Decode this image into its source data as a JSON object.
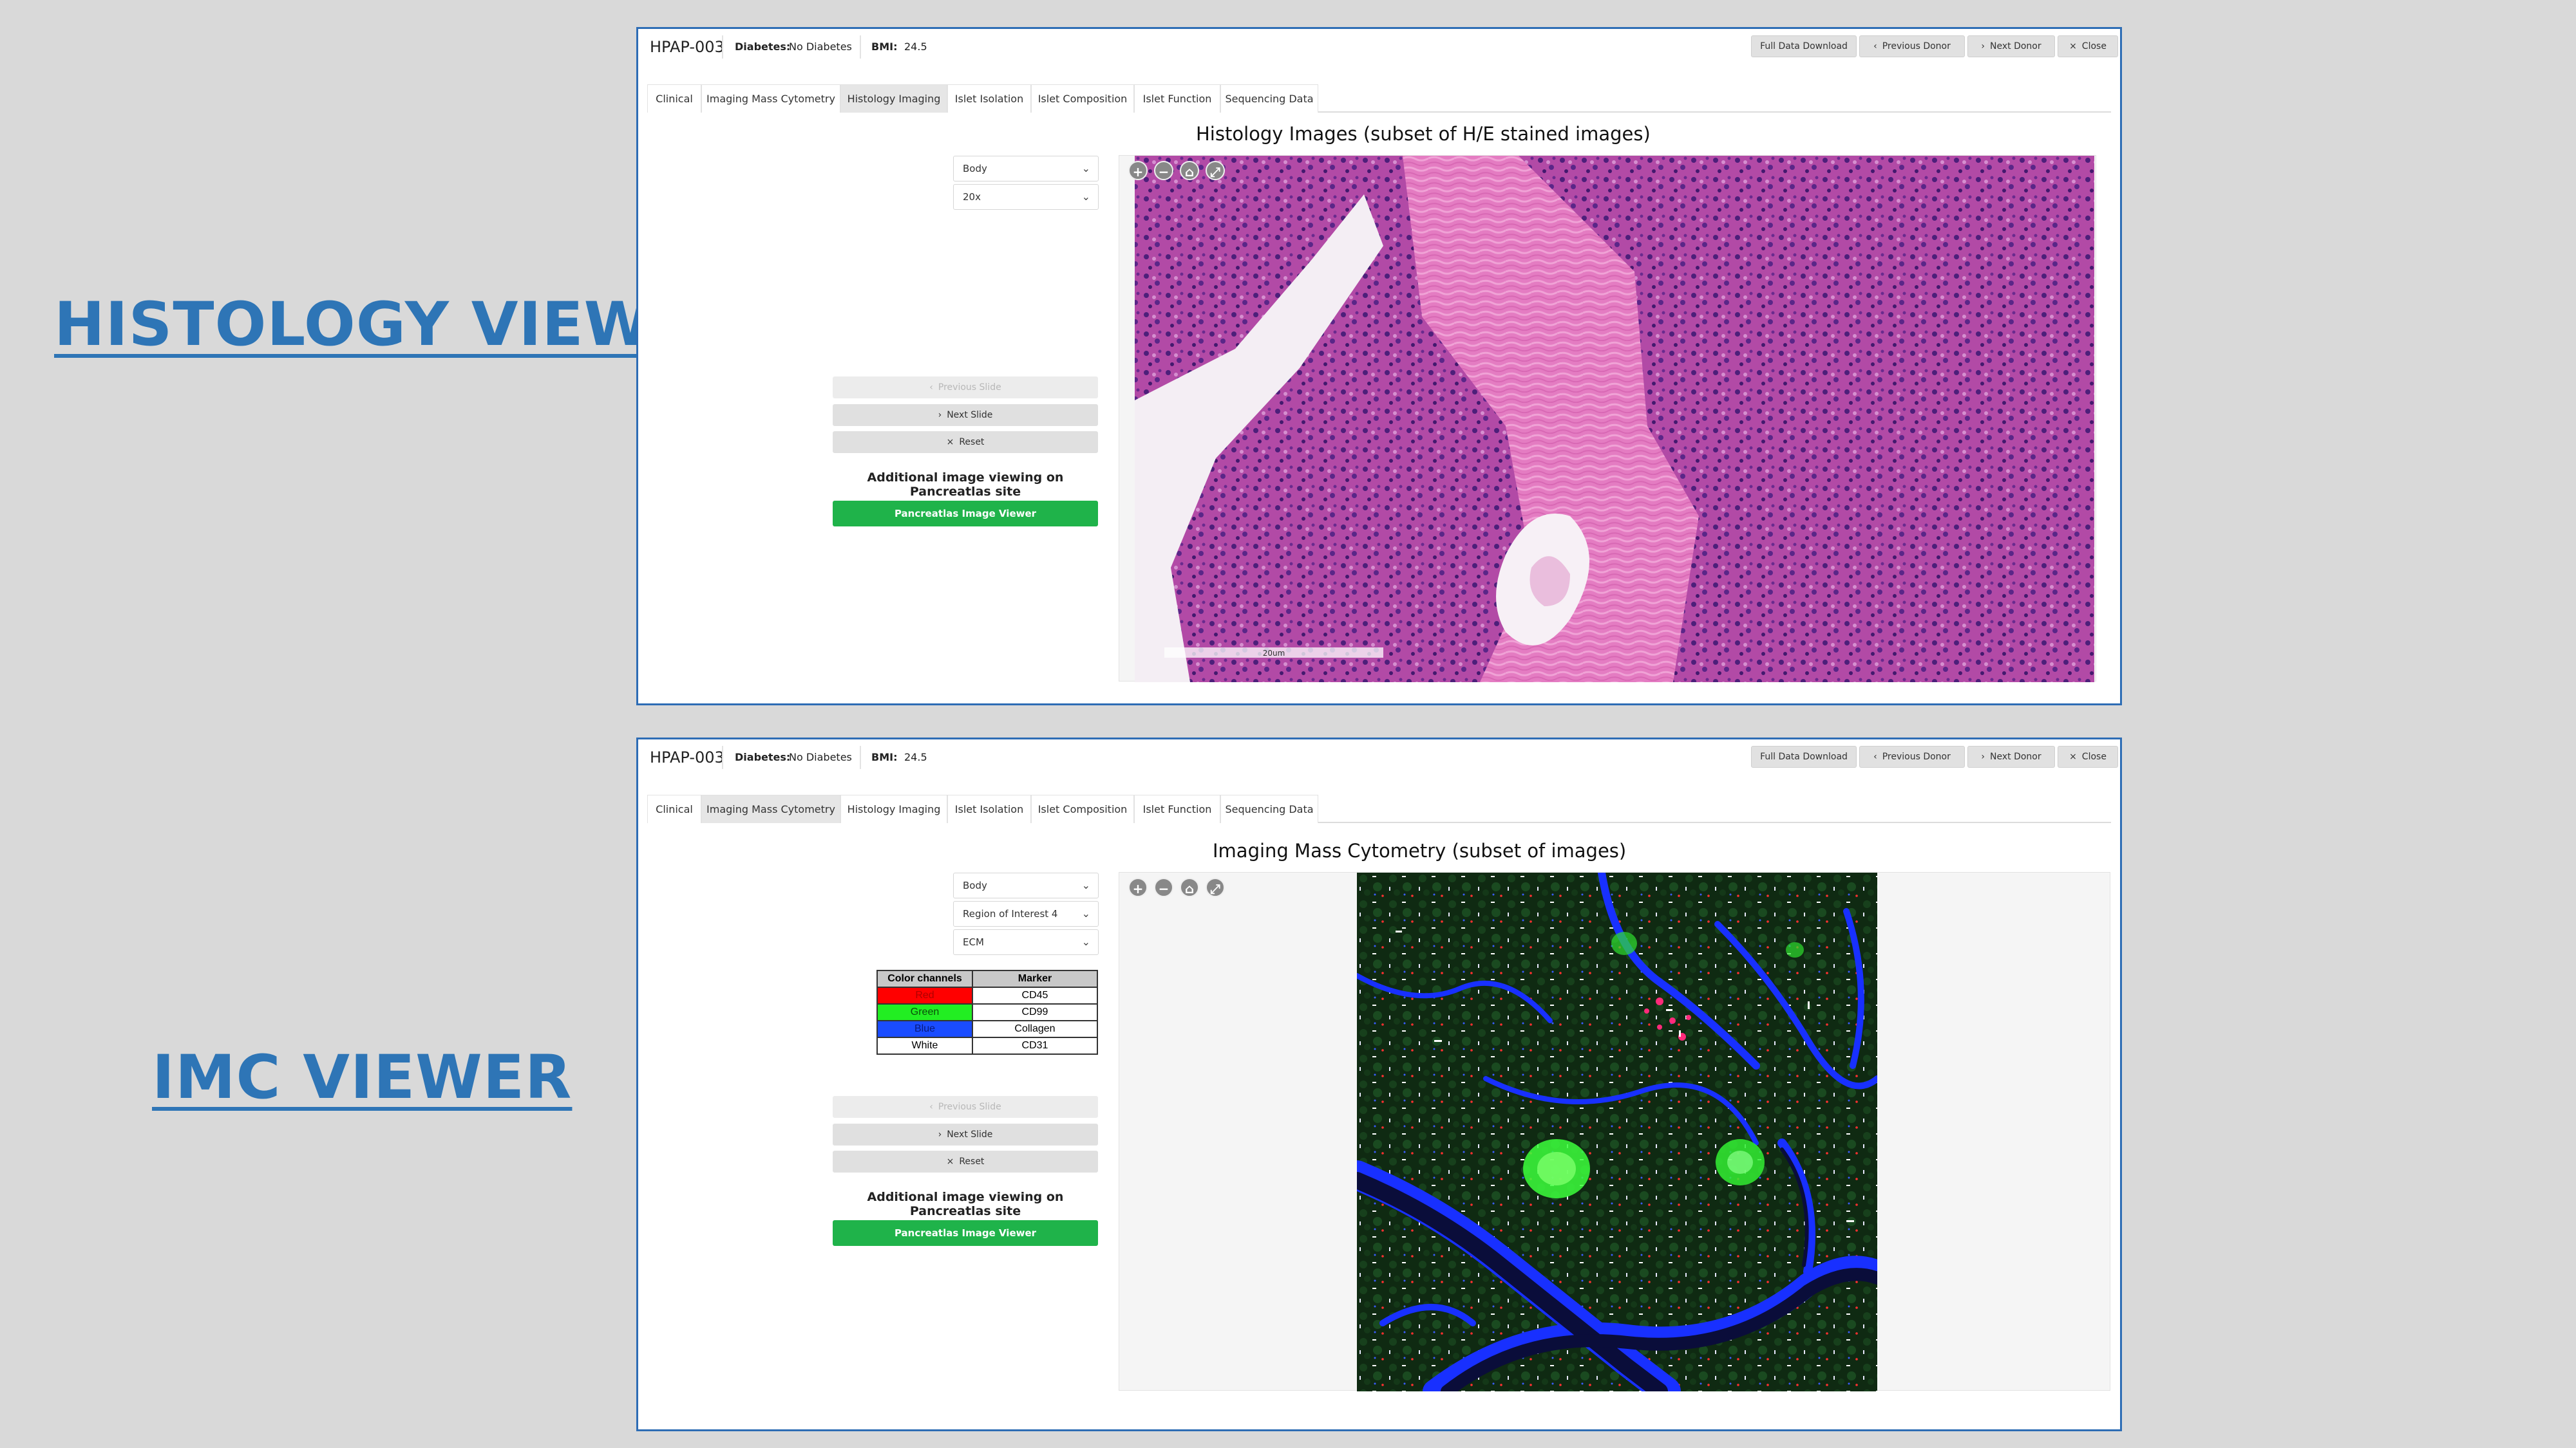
{
  "labels": {
    "histology": "HISTOLOGY VIEWER",
    "imc": "IMC VIEWER"
  },
  "donor": {
    "id": "HPAP-003",
    "diabetes_label": "Diabetes:",
    "diabetes_value": "No Diabetes",
    "bmi_label": "BMI:",
    "bmi_value": "24.5"
  },
  "header_buttons": {
    "download": "Full Data Download",
    "previous": "Previous Donor",
    "next": "Next Donor",
    "close": "Close"
  },
  "tabs": [
    "Clinical",
    "Imaging Mass Cytometry",
    "Histology Imaging",
    "Islet Isolation",
    "Islet Composition",
    "Islet Function",
    "Sequencing Data"
  ],
  "histology": {
    "active_tab": "Histology Imaging",
    "title": "Histology Images (subset of H/E stained images)",
    "region_select": "Body",
    "zoom_select": "20x",
    "scale_bar": "20um"
  },
  "imc": {
    "active_tab": "Imaging Mass Cytometry",
    "title": "Imaging Mass Cytometry (subset of images)",
    "region_select": "Body",
    "roi_select": "Region of Interest 4",
    "panel_select": "ECM",
    "channel_table": {
      "headers": [
        "Color channels",
        "Marker"
      ],
      "rows": [
        {
          "channel": "Red",
          "marker": "CD45",
          "color": "#ff0000"
        },
        {
          "channel": "Green",
          "marker": "CD99",
          "color": "#22ee22"
        },
        {
          "channel": "Blue",
          "marker": "Collagen",
          "color": "#1a4cff"
        },
        {
          "channel": "White",
          "marker": "CD31",
          "color": "#ffffff"
        }
      ]
    }
  },
  "slide_controls": {
    "previous": "Previous Slide",
    "next": "Next Slide",
    "reset": "Reset"
  },
  "additional": {
    "text": "Additional image viewing on Pancreatlas site",
    "button": "Pancreatlas Image Viewer"
  },
  "colors": {
    "accent": "#2e75b6",
    "green_button": "#1fb34a",
    "panel_border": "#2e6db5"
  }
}
